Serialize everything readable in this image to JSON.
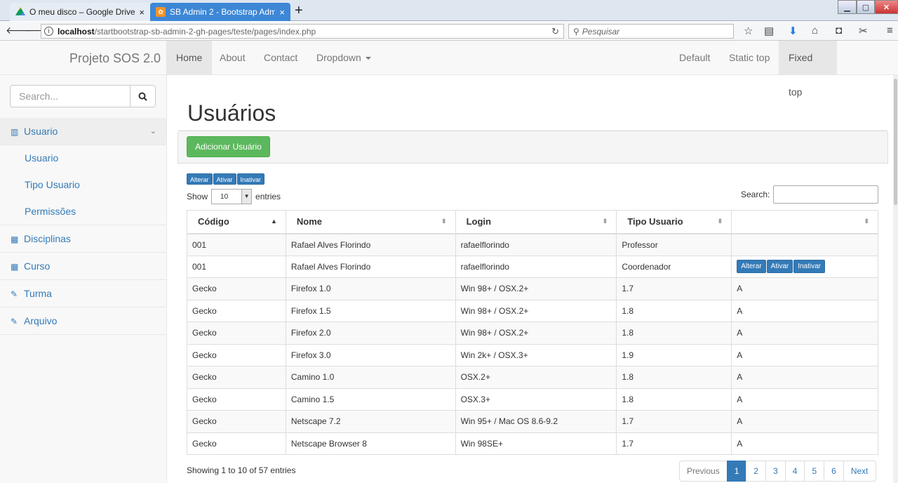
{
  "browser": {
    "tabs": [
      {
        "title": "O meu disco – Google Drive",
        "close": "×"
      },
      {
        "title": "SB Admin 2 - Bootstrap Adm",
        "close": "×"
      }
    ],
    "new_tab": "+",
    "url_host": "localhost",
    "url_path": "/startbootstrap-sb-admin-2-gh-pages/teste/pages/index.php",
    "search_placeholder": "Pesquisar"
  },
  "topnav": {
    "brand": "Projeto SOS 2.0",
    "left": [
      "Home",
      "About",
      "Contact",
      "Dropdown"
    ],
    "right": [
      "Default",
      "Static top",
      "Fixed top"
    ]
  },
  "sidebar": {
    "search_placeholder": "Search...",
    "items": [
      {
        "label": "Usuario",
        "icon": "bar-chart-icon"
      },
      {
        "label": "Usuario"
      },
      {
        "label": "Tipo Usuario"
      },
      {
        "label": "Permissões"
      },
      {
        "label": "Disciplinas",
        "icon": "table-icon"
      },
      {
        "label": "Curso",
        "icon": "table-icon"
      },
      {
        "label": "Turma",
        "icon": "edit-icon"
      },
      {
        "label": "Arquivo",
        "icon": "edit-icon"
      }
    ]
  },
  "main": {
    "title": "Usuários",
    "add_button": "Adicionar Usuário",
    "mini_buttons": [
      "Alterar",
      "Ativar",
      "Inativar"
    ],
    "show": "Show",
    "entries_value": "10",
    "entries": "entries",
    "search_label": "Search:",
    "columns": [
      "Código",
      "Nome",
      "Login",
      "Tipo Usuario",
      ""
    ],
    "rows": [
      [
        "001",
        "Rafael Alves Florindo",
        "rafaelflorindo",
        "Professor",
        ""
      ],
      [
        "001",
        "Rafael Alves Florindo",
        "rafaelflorindo",
        "Coordenador",
        ""
      ],
      [
        "Gecko",
        "Firefox 1.0",
        "Win 98+ / OSX.2+",
        "1.7",
        "A"
      ],
      [
        "Gecko",
        "Firefox 1.5",
        "Win 98+ / OSX.2+",
        "1.8",
        "A"
      ],
      [
        "Gecko",
        "Firefox 2.0",
        "Win 98+ / OSX.2+",
        "1.8",
        "A"
      ],
      [
        "Gecko",
        "Firefox 3.0",
        "Win 2k+ / OSX.3+",
        "1.9",
        "A"
      ],
      [
        "Gecko",
        "Camino 1.0",
        "OSX.2+",
        "1.8",
        "A"
      ],
      [
        "Gecko",
        "Camino 1.5",
        "OSX.3+",
        "1.8",
        "A"
      ],
      [
        "Gecko",
        "Netscape 7.2",
        "Win 95+ / Mac OS 8.6-9.2",
        "1.7",
        "A"
      ],
      [
        "Gecko",
        "Netscape Browser 8",
        "Win 98SE+",
        "1.7",
        "A"
      ]
    ],
    "row_buttons": [
      "Alterar",
      "Ativar",
      "Inativar"
    ],
    "info": "Showing 1 to 10 of 57 entries",
    "pager": [
      "Previous",
      "1",
      "2",
      "3",
      "4",
      "5",
      "6",
      "Next"
    ]
  },
  "colors": {
    "primary": "#337ab7",
    "success": "#5cb85c"
  }
}
